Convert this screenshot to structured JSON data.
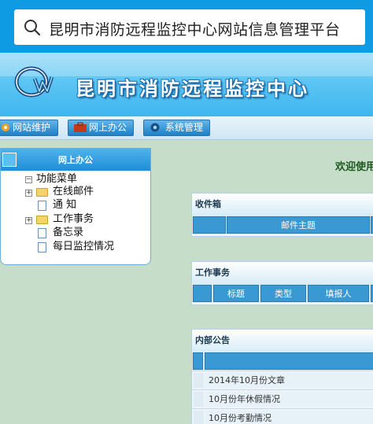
{
  "browser": {
    "search_text": "昆明市消防远程监控中心网站信息管理平台"
  },
  "banner": {
    "title": "昆明市消防远程监控中心"
  },
  "nav": {
    "items": [
      {
        "label": "网站维护",
        "icon": "gear-orange-icon"
      },
      {
        "label": "网上办公",
        "icon": "briefcase-icon"
      },
      {
        "label": "系统管理",
        "icon": "gear-blue-icon"
      }
    ]
  },
  "sidebar": {
    "title": "网上办公",
    "tree": {
      "root": "功能菜单",
      "items": [
        "在线邮件",
        "通 知",
        "工作事务",
        "备忘录",
        "每日监控情况"
      ]
    }
  },
  "main": {
    "welcome": "欢迎使用",
    "inbox": {
      "title": "收件箱",
      "columns": [
        "邮件主题"
      ]
    },
    "tasks": {
      "title": "工作事务",
      "columns": [
        "标题",
        "类型",
        "填报人"
      ]
    },
    "notices": {
      "title": "内部公告",
      "rows": [
        "2014年10月份文章",
        "10月份年休假情况",
        "10月份考勤情况"
      ]
    }
  },
  "colors": {
    "accent": "#0e9be3",
    "header_blue": "#3a98d2",
    "page_bg": "#c6dec9"
  }
}
